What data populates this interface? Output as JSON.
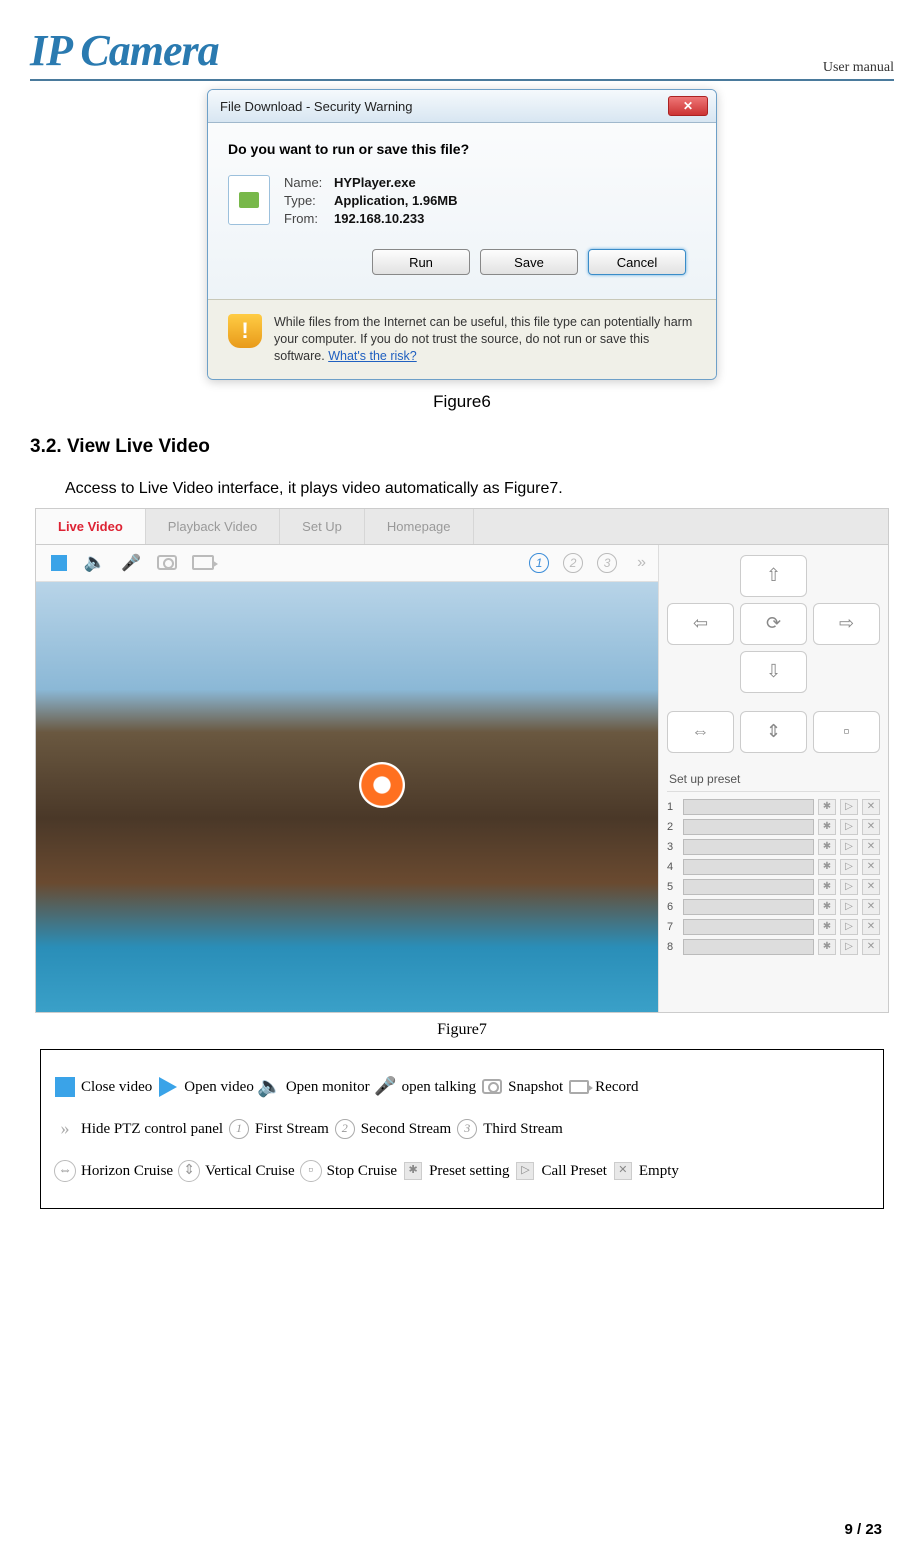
{
  "header": {
    "logo": "IP Camera",
    "right": "User manual"
  },
  "dialog": {
    "title": "File Download - Security Warning",
    "prompt": "Do you want to run or save this file?",
    "name_label": "Name:",
    "name_value": "HYPlayer.exe",
    "type_label": "Type:",
    "type_value": "Application, 1.96MB",
    "from_label": "From:",
    "from_value": "192.168.10.233",
    "btn_run": "Run",
    "btn_save": "Save",
    "btn_cancel": "Cancel",
    "warning": "While files from the Internet can be useful, this file type can potentially harm your computer. If you do not trust the source, do not run or save this software. ",
    "risk_link": "What's the risk?"
  },
  "figure6_caption": "Figure6",
  "section": {
    "heading": "3.2. View Live Video",
    "body": "Access to Live Video interface, it plays video automatically as Figure7."
  },
  "liveui": {
    "tabs": [
      "Live Video",
      "Playback Video",
      "Set Up",
      "Homepage"
    ],
    "streams": [
      "1",
      "2",
      "3"
    ],
    "preset_header": "Set up preset",
    "preset_rows": [
      "1",
      "2",
      "3",
      "4",
      "5",
      "6",
      "7",
      "8"
    ]
  },
  "figure7_caption": "Figure7",
  "legend": {
    "close_video": "Close video",
    "open_video": "Open video",
    "open_monitor": "Open monitor",
    "open_talking": "open talking",
    "snapshot": "Snapshot",
    "record": "Record",
    "hide_ptz": "Hide PTZ control panel",
    "first_stream": "First Stream",
    "second_stream": "Second Stream",
    "third_stream": "Third Stream",
    "hcruise": "Horizon Cruise",
    "vcruise": "Vertical Cruise",
    "scruise": "Stop Cruise",
    "preset_setting": "Preset setting",
    "call_preset": "Call Preset",
    "empty": "Empty"
  },
  "footer": {
    "page": "9 / 23"
  }
}
